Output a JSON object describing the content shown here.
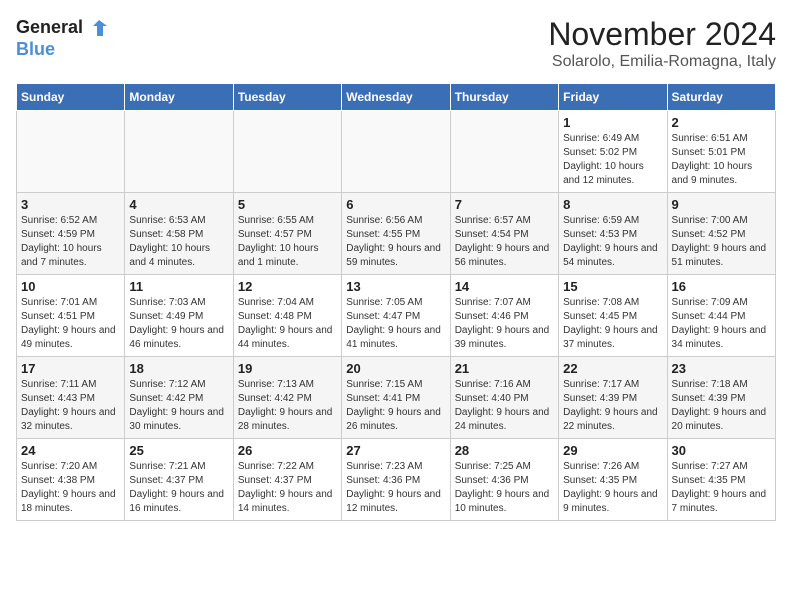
{
  "header": {
    "logo_line1": "General",
    "logo_line2": "Blue",
    "month": "November 2024",
    "location": "Solarolo, Emilia-Romagna, Italy"
  },
  "weekdays": [
    "Sunday",
    "Monday",
    "Tuesday",
    "Wednesday",
    "Thursday",
    "Friday",
    "Saturday"
  ],
  "weeks": [
    [
      {
        "day": "",
        "info": ""
      },
      {
        "day": "",
        "info": ""
      },
      {
        "day": "",
        "info": ""
      },
      {
        "day": "",
        "info": ""
      },
      {
        "day": "",
        "info": ""
      },
      {
        "day": "1",
        "info": "Sunrise: 6:49 AM\nSunset: 5:02 PM\nDaylight: 10 hours and 12 minutes."
      },
      {
        "day": "2",
        "info": "Sunrise: 6:51 AM\nSunset: 5:01 PM\nDaylight: 10 hours and 9 minutes."
      }
    ],
    [
      {
        "day": "3",
        "info": "Sunrise: 6:52 AM\nSunset: 4:59 PM\nDaylight: 10 hours and 7 minutes."
      },
      {
        "day": "4",
        "info": "Sunrise: 6:53 AM\nSunset: 4:58 PM\nDaylight: 10 hours and 4 minutes."
      },
      {
        "day": "5",
        "info": "Sunrise: 6:55 AM\nSunset: 4:57 PM\nDaylight: 10 hours and 1 minute."
      },
      {
        "day": "6",
        "info": "Sunrise: 6:56 AM\nSunset: 4:55 PM\nDaylight: 9 hours and 59 minutes."
      },
      {
        "day": "7",
        "info": "Sunrise: 6:57 AM\nSunset: 4:54 PM\nDaylight: 9 hours and 56 minutes."
      },
      {
        "day": "8",
        "info": "Sunrise: 6:59 AM\nSunset: 4:53 PM\nDaylight: 9 hours and 54 minutes."
      },
      {
        "day": "9",
        "info": "Sunrise: 7:00 AM\nSunset: 4:52 PM\nDaylight: 9 hours and 51 minutes."
      }
    ],
    [
      {
        "day": "10",
        "info": "Sunrise: 7:01 AM\nSunset: 4:51 PM\nDaylight: 9 hours and 49 minutes."
      },
      {
        "day": "11",
        "info": "Sunrise: 7:03 AM\nSunset: 4:49 PM\nDaylight: 9 hours and 46 minutes."
      },
      {
        "day": "12",
        "info": "Sunrise: 7:04 AM\nSunset: 4:48 PM\nDaylight: 9 hours and 44 minutes."
      },
      {
        "day": "13",
        "info": "Sunrise: 7:05 AM\nSunset: 4:47 PM\nDaylight: 9 hours and 41 minutes."
      },
      {
        "day": "14",
        "info": "Sunrise: 7:07 AM\nSunset: 4:46 PM\nDaylight: 9 hours and 39 minutes."
      },
      {
        "day": "15",
        "info": "Sunrise: 7:08 AM\nSunset: 4:45 PM\nDaylight: 9 hours and 37 minutes."
      },
      {
        "day": "16",
        "info": "Sunrise: 7:09 AM\nSunset: 4:44 PM\nDaylight: 9 hours and 34 minutes."
      }
    ],
    [
      {
        "day": "17",
        "info": "Sunrise: 7:11 AM\nSunset: 4:43 PM\nDaylight: 9 hours and 32 minutes."
      },
      {
        "day": "18",
        "info": "Sunrise: 7:12 AM\nSunset: 4:42 PM\nDaylight: 9 hours and 30 minutes."
      },
      {
        "day": "19",
        "info": "Sunrise: 7:13 AM\nSunset: 4:42 PM\nDaylight: 9 hours and 28 minutes."
      },
      {
        "day": "20",
        "info": "Sunrise: 7:15 AM\nSunset: 4:41 PM\nDaylight: 9 hours and 26 minutes."
      },
      {
        "day": "21",
        "info": "Sunrise: 7:16 AM\nSunset: 4:40 PM\nDaylight: 9 hours and 24 minutes."
      },
      {
        "day": "22",
        "info": "Sunrise: 7:17 AM\nSunset: 4:39 PM\nDaylight: 9 hours and 22 minutes."
      },
      {
        "day": "23",
        "info": "Sunrise: 7:18 AM\nSunset: 4:39 PM\nDaylight: 9 hours and 20 minutes."
      }
    ],
    [
      {
        "day": "24",
        "info": "Sunrise: 7:20 AM\nSunset: 4:38 PM\nDaylight: 9 hours and 18 minutes."
      },
      {
        "day": "25",
        "info": "Sunrise: 7:21 AM\nSunset: 4:37 PM\nDaylight: 9 hours and 16 minutes."
      },
      {
        "day": "26",
        "info": "Sunrise: 7:22 AM\nSunset: 4:37 PM\nDaylight: 9 hours and 14 minutes."
      },
      {
        "day": "27",
        "info": "Sunrise: 7:23 AM\nSunset: 4:36 PM\nDaylight: 9 hours and 12 minutes."
      },
      {
        "day": "28",
        "info": "Sunrise: 7:25 AM\nSunset: 4:36 PM\nDaylight: 9 hours and 10 minutes."
      },
      {
        "day": "29",
        "info": "Sunrise: 7:26 AM\nSunset: 4:35 PM\nDaylight: 9 hours and 9 minutes."
      },
      {
        "day": "30",
        "info": "Sunrise: 7:27 AM\nSunset: 4:35 PM\nDaylight: 9 hours and 7 minutes."
      }
    ]
  ]
}
